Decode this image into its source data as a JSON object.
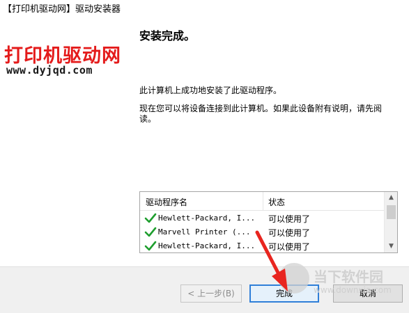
{
  "window": {
    "title": "【打印机驱动网】驱动安装器"
  },
  "logo": {
    "name_cn": "打印机驱动网",
    "url": "www.dyjqd.com"
  },
  "content": {
    "heading": "安装完成。",
    "line1": "此计算机上成功地安装了此驱动程序。",
    "line2": "现在您可以将设备连接到此计算机。如果此设备附有说明，请先阅读。"
  },
  "drivers_table": {
    "columns": [
      "驱动程序名",
      "状态"
    ],
    "rows": [
      {
        "name": "Hewlett-Packard, I...",
        "status": "可以使用了"
      },
      {
        "name": "Marvell Printer  (...",
        "status": "可以使用了"
      },
      {
        "name": "Hewlett-Packard, I...",
        "status": "可以使用了"
      }
    ]
  },
  "buttons": {
    "back": "< 上一步(B)",
    "finish": "完成",
    "cancel": "取消"
  },
  "watermark": {
    "name_cn": "当下软件园",
    "url": "www.downxia.com"
  },
  "colors": {
    "logo_red": "#e41b1b",
    "check_green": "#1e9e2e",
    "focus_blue": "#2f7fd8",
    "arrow_red": "#e8251f"
  },
  "icons": {
    "row_status": "check-icon",
    "scroll_up": "chevron-up-icon",
    "scroll_down": "chevron-down-icon"
  }
}
